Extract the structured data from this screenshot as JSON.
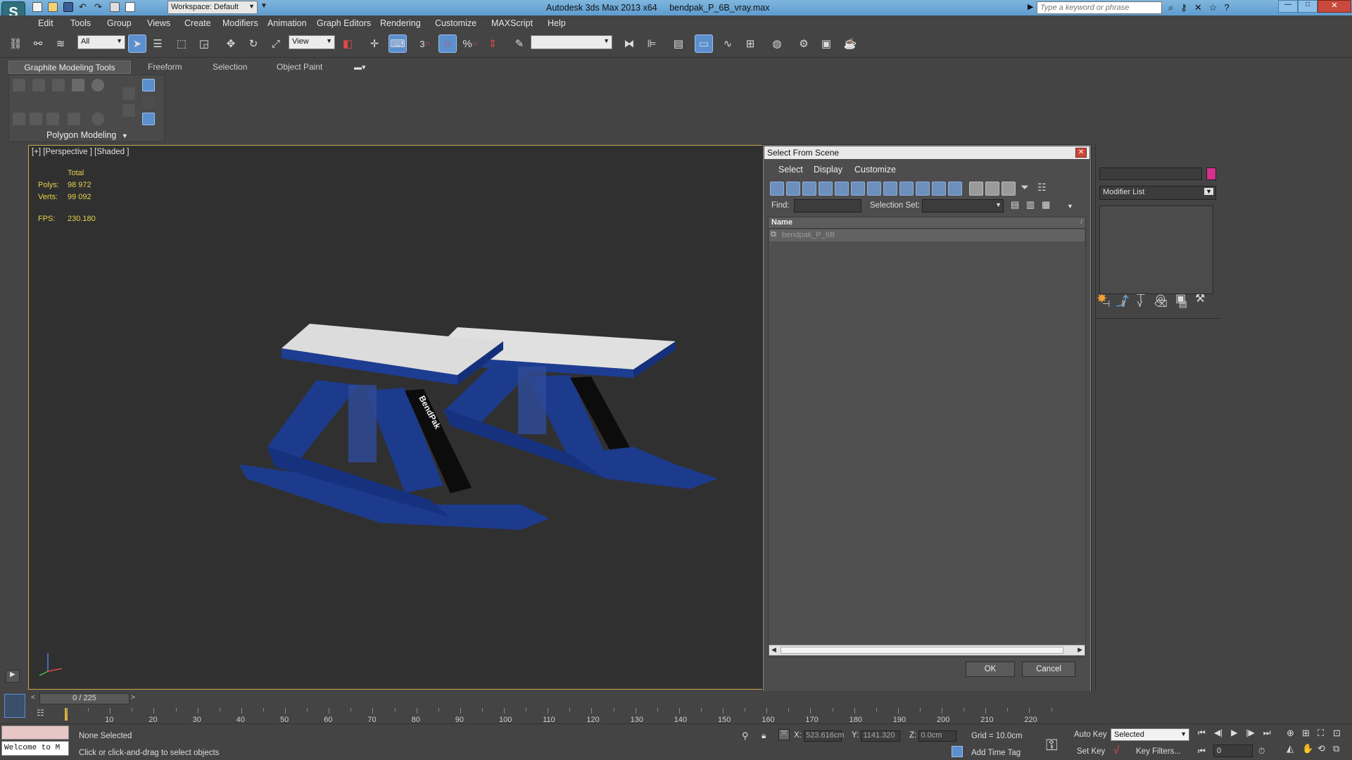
{
  "titlebar": {
    "workspace": "Workspace: Default",
    "app_title": "Autodesk 3ds Max  2013 x64",
    "file_name": "bendpak_P_6B_vray.max",
    "search_placeholder": "Type a keyword or phrase"
  },
  "menubar": [
    "Edit",
    "Tools",
    "Group",
    "Views",
    "Create",
    "Modifiers",
    "Animation",
    "Graph Editors",
    "Rendering",
    "Customize",
    "MAXScript",
    "Help"
  ],
  "main_toolbar": {
    "selection_filter": "All",
    "ref_coord": "View",
    "snap_label": "3",
    "angle_snap_label": "%"
  },
  "ribbon": {
    "tabs": [
      "Graphite Modeling Tools",
      "Freeform",
      "Selection",
      "Object Paint"
    ],
    "panel_label": "Polygon Modeling"
  },
  "viewport": {
    "label": "[+] [Perspective ] [Shaded ]",
    "stats_header": "Total",
    "polys_label": "Polys:",
    "polys_value": "98 972",
    "verts_label": "Verts:",
    "verts_value": "99 092",
    "fps_label": "FPS:",
    "fps_value": "230.180",
    "model_brand": "BendPak"
  },
  "dialog": {
    "title": "Select From Scene",
    "menus": [
      "Select",
      "Display",
      "Customize"
    ],
    "find_label": "Find:",
    "find_value": "",
    "selection_set_label": "Selection Set:",
    "column_name": "Name",
    "items": [
      "bendpak_P_6B"
    ],
    "ok": "OK",
    "cancel": "Cancel"
  },
  "command_panel": {
    "modifier_list": "Modifier List"
  },
  "timeline": {
    "frame_display": "0 / 225",
    "ticks": [
      "10",
      "20",
      "30",
      "40",
      "50",
      "60",
      "70",
      "80",
      "90",
      "100",
      "110",
      "120",
      "130",
      "140",
      "150",
      "160",
      "170",
      "180",
      "190",
      "200",
      "210",
      "220"
    ]
  },
  "statusbar": {
    "maxscript_listener": "Welcome to M",
    "selection_status": "None Selected",
    "prompt": "Click or click-and-drag to select objects",
    "x_label": "X:",
    "x_value": "523.616cm",
    "y_label": "Y:",
    "y_value": "1141.320",
    "z_label": "Z:",
    "z_value": "0.0cm",
    "grid": "Grid = 10.0cm",
    "add_time_tag": "Add Time Tag",
    "auto_key": "Auto Key",
    "auto_key_mode": "Selected",
    "set_key": "Set Key",
    "key_filters": "Key Filters...",
    "current_frame": "0"
  },
  "colors": {
    "ui_bg": "#444444",
    "viewport_bg": "#303030",
    "lift_blue": "#1c3b8c",
    "active_blue": "#5b8fce",
    "swatch_magenta": "#d6318c",
    "stats_yellow": "#e6d24a"
  }
}
